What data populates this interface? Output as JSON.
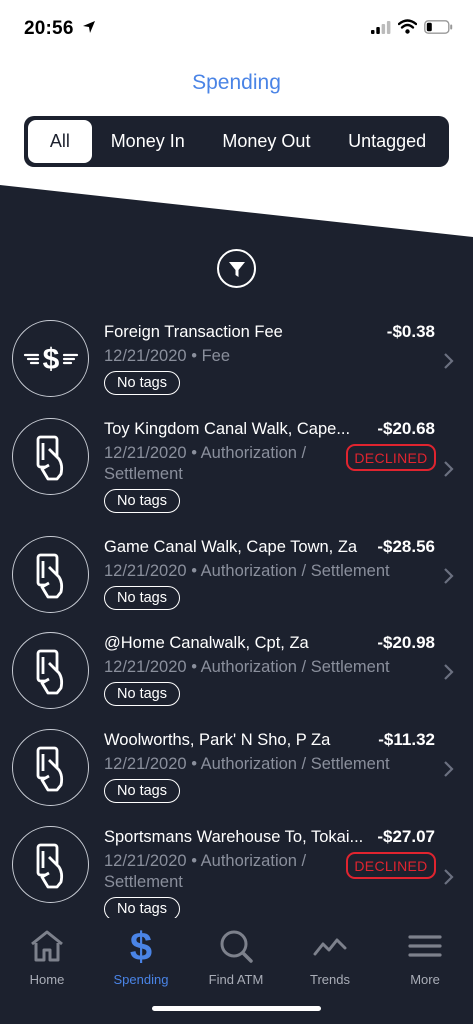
{
  "status_bar": {
    "time": "20:56"
  },
  "header": {
    "title": "Spending"
  },
  "segments": [
    {
      "label": "All",
      "active": true
    },
    {
      "label": "Money In",
      "active": false
    },
    {
      "label": "Money Out",
      "active": false
    },
    {
      "label": "Untagged",
      "active": false
    }
  ],
  "transactions": [
    {
      "name": "Foreign Transaction Fee",
      "amount": "-$0.38",
      "date": "12/21/2020",
      "separator": "•",
      "category": "Fee",
      "category_line2": "",
      "tag": "No tags",
      "declined": "",
      "icon": "winged-dollar-icon"
    },
    {
      "name": "Toy Kingdom Canal Walk, Cape...",
      "amount": "-$20.68",
      "date": "12/21/2020",
      "separator": "•",
      "category": "Authorization /",
      "category_line2": "Settlement",
      "tag": "No tags",
      "declined": "DECLINED",
      "icon": "card-hand-icon"
    },
    {
      "name": "Game Canal Walk, Cape Town, Za",
      "amount": "-$28.56",
      "date": "12/21/2020",
      "separator": "•",
      "category": "Authorization / Settlement",
      "category_line2": "",
      "tag": "No tags",
      "declined": "",
      "icon": "card-hand-icon"
    },
    {
      "name": "@Home Canalwalk, Cpt, Za",
      "amount": "-$20.98",
      "date": "12/21/2020",
      "separator": "•",
      "category": "Authorization / Settlement",
      "category_line2": "",
      "tag": "No tags",
      "declined": "",
      "icon": "card-hand-icon"
    },
    {
      "name": "Woolworths, Park' N Sho, P Za",
      "amount": "-$11.32",
      "date": "12/21/2020",
      "separator": "•",
      "category": "Authorization / Settlement",
      "category_line2": "",
      "tag": "No tags",
      "declined": "",
      "icon": "card-hand-icon"
    },
    {
      "name": "Sportsmans Warehouse To, Tokai...",
      "amount": "-$27.07",
      "date": "12/21/2020",
      "separator": "•",
      "category": "Authorization /",
      "category_line2": "Settlement",
      "tag": "No tags",
      "declined": "DECLINED",
      "icon": "card-hand-icon"
    }
  ],
  "tabbar": [
    {
      "label": "Home",
      "icon": "home-icon",
      "active": false
    },
    {
      "label": "Spending",
      "icon": "dollar-icon",
      "active": true
    },
    {
      "label": "Find ATM",
      "icon": "search-icon",
      "active": false
    },
    {
      "label": "Trends",
      "icon": "trends-icon",
      "active": false
    },
    {
      "label": "More",
      "icon": "menu-icon",
      "active": false
    }
  ],
  "colors": {
    "accent": "#4a84e6",
    "background": "#1c212e",
    "declined": "#e0242f"
  }
}
